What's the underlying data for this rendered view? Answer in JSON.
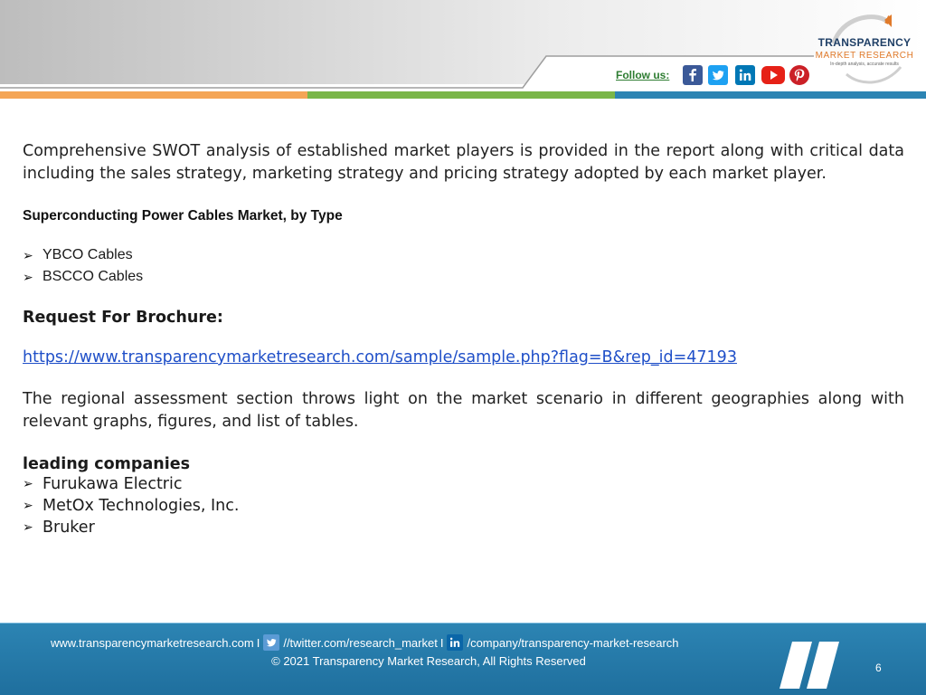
{
  "header": {
    "logo": {
      "line1": "TRANSPARENCY",
      "line2": "MARKET RESEARCH",
      "tagline": "In-depth analysis, accurate results"
    },
    "follow_label": "Follow us:",
    "social_icons": [
      "facebook-icon",
      "twitter-icon",
      "linkedin-icon",
      "youtube-icon",
      "pinterest-icon"
    ],
    "stripe_colors": [
      "#f4a556",
      "#7ab648",
      "#2c84b3"
    ]
  },
  "body": {
    "intro": "Comprehensive SWOT analysis of established market players is provided in the report along with critical data including the sales strategy, marketing strategy and pricing strategy adopted by each market player.",
    "type_heading": "Superconducting Power Cables Market, by Type",
    "types": [
      "YBCO Cables",
      "BSCCO Cables"
    ],
    "brochure_heading": "Request For Brochure:",
    "brochure_link": "https://www.transparencymarketresearch.com/sample/sample.php?flag=B&rep_id=47193",
    "regional": "The regional assessment section throws light on the market scenario in different geographies along with relevant graphs, figures, and list of tables.",
    "companies_heading": "leading companies",
    "companies": [
      "Furukawa Electric",
      "MetOx Technologies, Inc.",
      "Bruker"
    ]
  },
  "footer": {
    "website": "www.transparencymarketresearch.com",
    "sep1": "I",
    "twitter": "//twitter.com/research_market",
    "sep2": "I",
    "linkedin": "/company/transparency-market-research",
    "copyright": "© 2021 Transparency Market Research, All Rights Reserved",
    "page_number": "6",
    "background_color": "#2c84b3"
  }
}
